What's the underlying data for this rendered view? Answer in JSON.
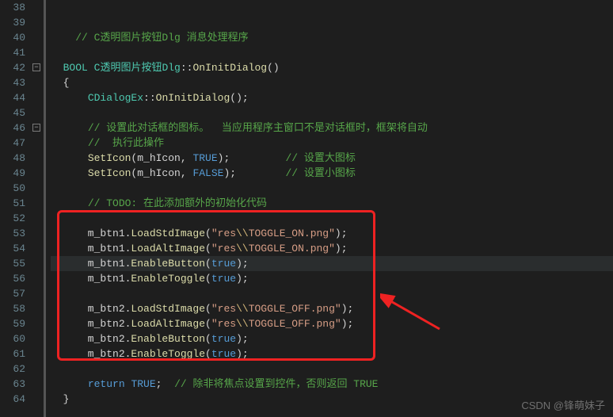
{
  "lines": [
    {
      "n": "38",
      "html": ""
    },
    {
      "n": "39",
      "html": ""
    },
    {
      "n": "40",
      "html": "    <span class='c-comment'>// C透明图片按钮Dlg 消息处理程序</span>"
    },
    {
      "n": "41",
      "html": ""
    },
    {
      "n": "42",
      "html": "  <span class='c-type'>BOOL</span> <span class='c-type'>C透明图片按钮Dlg</span>::<span class='c-func'>OnInitDialog</span>()",
      "fold": "-"
    },
    {
      "n": "43",
      "html": "  {"
    },
    {
      "n": "44",
      "html": "      <span class='c-type'>CDialogEx</span>::<span class='c-func'>OnInitDialog</span>();"
    },
    {
      "n": "45",
      "html": ""
    },
    {
      "n": "46",
      "html": "      <span class='c-comment'>// 设置此对话框的图标。  当应用程序主窗口不是对话框时，框架将自动</span>",
      "fold": "-"
    },
    {
      "n": "47",
      "html": "      <span class='c-comment'>//  执行此操作</span>"
    },
    {
      "n": "48",
      "html": "      <span class='c-func'>SetIcon</span>(m_hIcon, <span class='c-const'>TRUE</span>);         <span class='c-comment'>// 设置大图标</span>"
    },
    {
      "n": "49",
      "html": "      <span class='c-func'>SetIcon</span>(m_hIcon, <span class='c-const'>FALSE</span>);        <span class='c-comment'>// 设置小图标</span>"
    },
    {
      "n": "50",
      "html": ""
    },
    {
      "n": "51",
      "html": "      <span class='c-comment'>// TODO: 在此添加额外的初始化代码</span>"
    },
    {
      "n": "52",
      "html": ""
    },
    {
      "n": "53",
      "html": "      m_btn1.<span class='c-func'>LoadStdImage</span>(<span class='c-string'>\"res<span class='c-escape'>\\\\</span>TOGGLE_ON.png\"</span>);"
    },
    {
      "n": "54",
      "html": "      m_btn1.<span class='c-func'>LoadAltImage</span>(<span class='c-string'>\"res<span class='c-escape'>\\\\</span>TOGGLE_ON.png\"</span>);"
    },
    {
      "n": "55",
      "html": "      m_btn1.<span class='c-func'>EnableButton</span>(<span class='c-const'>true</span>);",
      "hl": true
    },
    {
      "n": "56",
      "html": "      m_btn1.<span class='c-func'>EnableToggle</span>(<span class='c-const'>true</span>);"
    },
    {
      "n": "57",
      "html": ""
    },
    {
      "n": "58",
      "html": "      m_btn2.<span class='c-func'>LoadStdImage</span>(<span class='c-string'>\"res<span class='c-escape'>\\\\</span>TOGGLE_OFF.png\"</span>);"
    },
    {
      "n": "59",
      "html": "      m_btn2.<span class='c-func'>LoadAltImage</span>(<span class='c-string'>\"res<span class='c-escape'>\\\\</span>TOGGLE_OFF.png\"</span>);"
    },
    {
      "n": "60",
      "html": "      m_btn2.<span class='c-func'>EnableButton</span>(<span class='c-const'>true</span>);"
    },
    {
      "n": "61",
      "html": "      m_btn2.<span class='c-func'>EnableToggle</span>(<span class='c-const'>true</span>);"
    },
    {
      "n": "62",
      "html": ""
    },
    {
      "n": "63",
      "html": "      <span class='c-keyword'>return</span> <span class='c-const'>TRUE</span>;  <span class='c-comment'>// 除非将焦点设置到控件，否则返回 TRUE</span>"
    },
    {
      "n": "64",
      "html": "  }"
    }
  ],
  "watermark": "CSDN @锋萌妹子"
}
